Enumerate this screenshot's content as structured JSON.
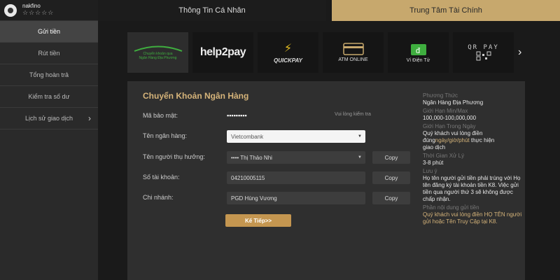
{
  "user": {
    "name": "nakfino",
    "stars": "☆☆☆☆☆"
  },
  "sidebar": {
    "items": [
      {
        "label": "Gửi tiền"
      },
      {
        "label": "Rút tiền"
      },
      {
        "label": "Tổng hoàn trả"
      },
      {
        "label": "Kiểm tra số dư"
      },
      {
        "label": "Lịch sử giao dịch"
      }
    ]
  },
  "tabs": [
    {
      "label": "Thông Tin Cá Nhân"
    },
    {
      "label": "Trung Tâm Tài Chính"
    }
  ],
  "methods": [
    {
      "name": "local-bank",
      "line1": "Chuyển khoản qua",
      "line2": "Ngân Hàng Địa Phương"
    },
    {
      "name": "help2pay",
      "text": "help2pay"
    },
    {
      "name": "quickpay",
      "label": "QUICKPAY"
    },
    {
      "name": "atm-online",
      "label": "ATM ONLINE"
    },
    {
      "name": "e-wallet",
      "label": "Ví Điện Tử"
    },
    {
      "name": "qr-pay",
      "text": "QR PAY"
    }
  ],
  "form": {
    "title": "Chuyển Khoản Ngân Hàng",
    "security_label": "Mã bảo mật:",
    "security_value": "▪▪▪▪▪▪▪▪▪",
    "security_hint": "Vui lòng kiểm tra",
    "bank_label": "Tên ngân hàng:",
    "bank_value": "Vietcombank",
    "beneficiary_label": "Tên người thụ hưởng:",
    "beneficiary_value": "•••• Thị Thảo Nhi",
    "account_label": "Số tài khoản:",
    "account_value": "04210005115",
    "branch_label": "Chi nhánh:",
    "branch_value": "PGD Hùng Vương",
    "copy_label": "Copy",
    "next_label": "Kế Tiếp>>"
  },
  "info": {
    "method_key": "Phương Thức",
    "method_value": "Ngân Hàng Địa Phương",
    "limit_key": "Giới Hạn Min/Max",
    "limit_value": "100,000-100,000,000",
    "timelimit_key": "Giới Hạn Trong Ngày",
    "timelimit_value_1": "Quý khách vui lòng điền",
    "timelimit_value_2a": "đúng",
    "timelimit_value_2b": "ngày/giờ/phút",
    "timelimit_value_2c": " thực hiện",
    "timelimit_value_3": "giao dịch",
    "processing_key": "Thời Gian Xử Lý",
    "processing_value": "3-8 phút",
    "note_key": "Lưu ý",
    "note_value": "Họ tên người gửi tiền phải trùng với Họ tên đăng ký tài khoản tiền K8. Việc gửi tiền qua người thứ 3 sẽ không được chấp nhận.",
    "content_key": "Phần nội dung gửi tiền",
    "content_value": "Quý khách vui lòng điền HỌ TÊN người gửi hoặc Tên Truy Cập tại K8."
  },
  "colors": {
    "accent": "#c7a86d",
    "gold_text": "#d6b47a",
    "next_button": "#c49650"
  }
}
